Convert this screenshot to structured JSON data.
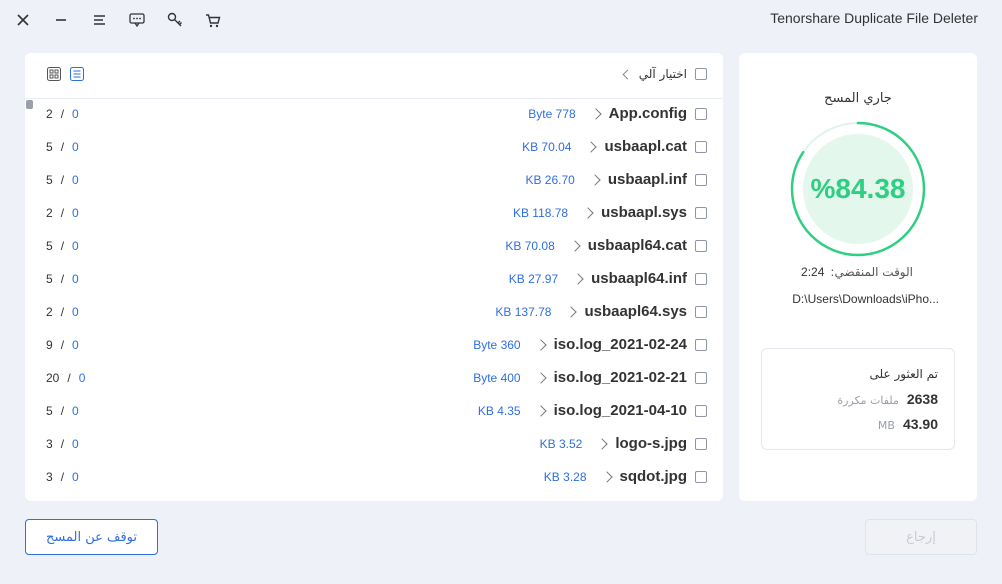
{
  "app": {
    "title": "Tenorshare Duplicate File Deleter"
  },
  "files_panel": {
    "auto_select_label": "اختيار آلي",
    "rows": [
      {
        "name": "App.config",
        "size": "Byte 778",
        "found": "0",
        "total": "2"
      },
      {
        "name": "usbaapl.cat",
        "size": "KB 70.04",
        "found": "0",
        "total": "5"
      },
      {
        "name": "usbaapl.inf",
        "size": "KB 26.70",
        "found": "0",
        "total": "5"
      },
      {
        "name": "usbaapl.sys",
        "size": "KB 118.78",
        "found": "0",
        "total": "2"
      },
      {
        "name": "usbaapl64.cat",
        "size": "KB 70.08",
        "found": "0",
        "total": "5"
      },
      {
        "name": "usbaapl64.inf",
        "size": "KB 27.97",
        "found": "0",
        "total": "5"
      },
      {
        "name": "usbaapl64.sys",
        "size": "KB 137.78",
        "found": "0",
        "total": "2"
      },
      {
        "name": "iso.log_2021-02-24",
        "size": "Byte 360",
        "found": "0",
        "total": "9"
      },
      {
        "name": "iso.log_2021-02-21",
        "size": "Byte 400",
        "found": "0",
        "total": "20"
      },
      {
        "name": "iso.log_2021-04-10",
        "size": "KB 4.35",
        "found": "0",
        "total": "5"
      },
      {
        "name": "logo-s.jpg",
        "size": "KB 3.52",
        "found": "0",
        "total": "3"
      },
      {
        "name": "sqdot.jpg",
        "size": "KB 3.28",
        "found": "0",
        "total": "3"
      }
    ]
  },
  "scan_panel": {
    "title": "جاري المسح",
    "percent_text": "%84.38",
    "progress": 0.8438,
    "elapsed_label": ":الوقت المنقضي",
    "elapsed_value": "2:24",
    "current_path": "D:\\Users\\Downloads\\iPho...",
    "found_title": "تم العثور على",
    "duplicate_count": "2638",
    "duplicate_label": "ملفات مكررة",
    "size_value": "43.90",
    "size_unit": "MB"
  },
  "buttons": {
    "stop_label": "توقف عن المسح",
    "back_label": "إرجاع"
  },
  "colors": {
    "accent": "#2f6fe0",
    "progress": "#2ecf82",
    "ring_track": "#e3f7ec"
  },
  "icons": [
    "close-icon",
    "minimize-icon",
    "menu-icon",
    "feedback-icon",
    "key-icon",
    "cart-icon",
    "grid-view-icon",
    "list-view-icon"
  ]
}
